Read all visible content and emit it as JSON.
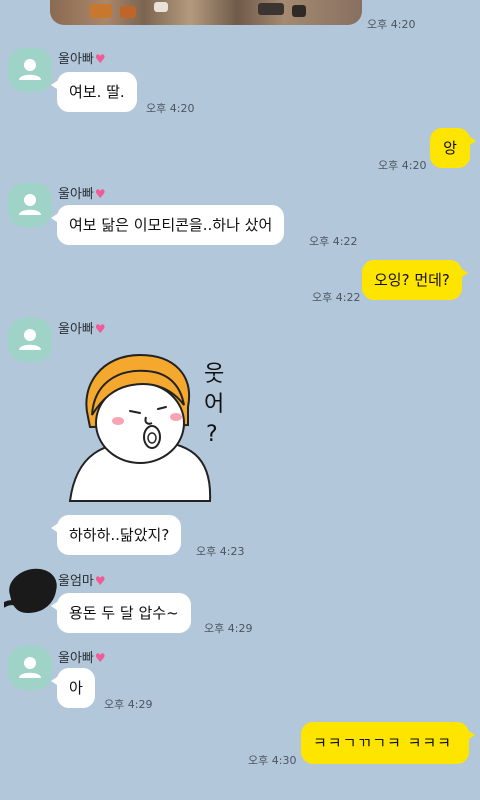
{
  "messages": [
    {
      "id": "m0",
      "side": "in",
      "type": "photo",
      "time": "오후 4:20"
    },
    {
      "id": "m1",
      "side": "in",
      "sender": "울아빠",
      "text": "여보. 딸.",
      "time": "오후 4:20"
    },
    {
      "id": "m2",
      "side": "out",
      "text": "앙",
      "time": "오후 4:20"
    },
    {
      "id": "m3",
      "side": "in",
      "sender": "울아빠",
      "text": "여보 닮은 이모티콘을..하나 샀어",
      "time": "오후 4:22"
    },
    {
      "id": "m4",
      "side": "out",
      "text": "오잉? 먼데?",
      "time": "오후 4:22"
    },
    {
      "id": "m5",
      "side": "in",
      "sender": "울아빠",
      "type": "sticker",
      "sticker_text": [
        "웃",
        "어",
        "?"
      ]
    },
    {
      "id": "m6",
      "side": "in",
      "text": "하하하..닮았지?",
      "time": "오후 4:23"
    },
    {
      "id": "m7",
      "side": "in",
      "sender": "울엄마",
      "text": "용돈 두 달 압수~",
      "time": "오후 4:29"
    },
    {
      "id": "m8",
      "side": "in",
      "sender": "울아빠",
      "text": "아",
      "time": "오후 4:29"
    },
    {
      "id": "m9",
      "side": "out",
      "text": "ㅋㅋㄱㄲㄱㅋ ㅋㅋㅋ",
      "time": "오후 4:30"
    }
  ],
  "heart_glyph": "♥",
  "colors": {
    "background": "#b2c7da",
    "incoming_bubble": "#ffffff",
    "outgoing_bubble": "#fee500",
    "avatar": "#9fd3c8",
    "heart": "#f05a96"
  }
}
